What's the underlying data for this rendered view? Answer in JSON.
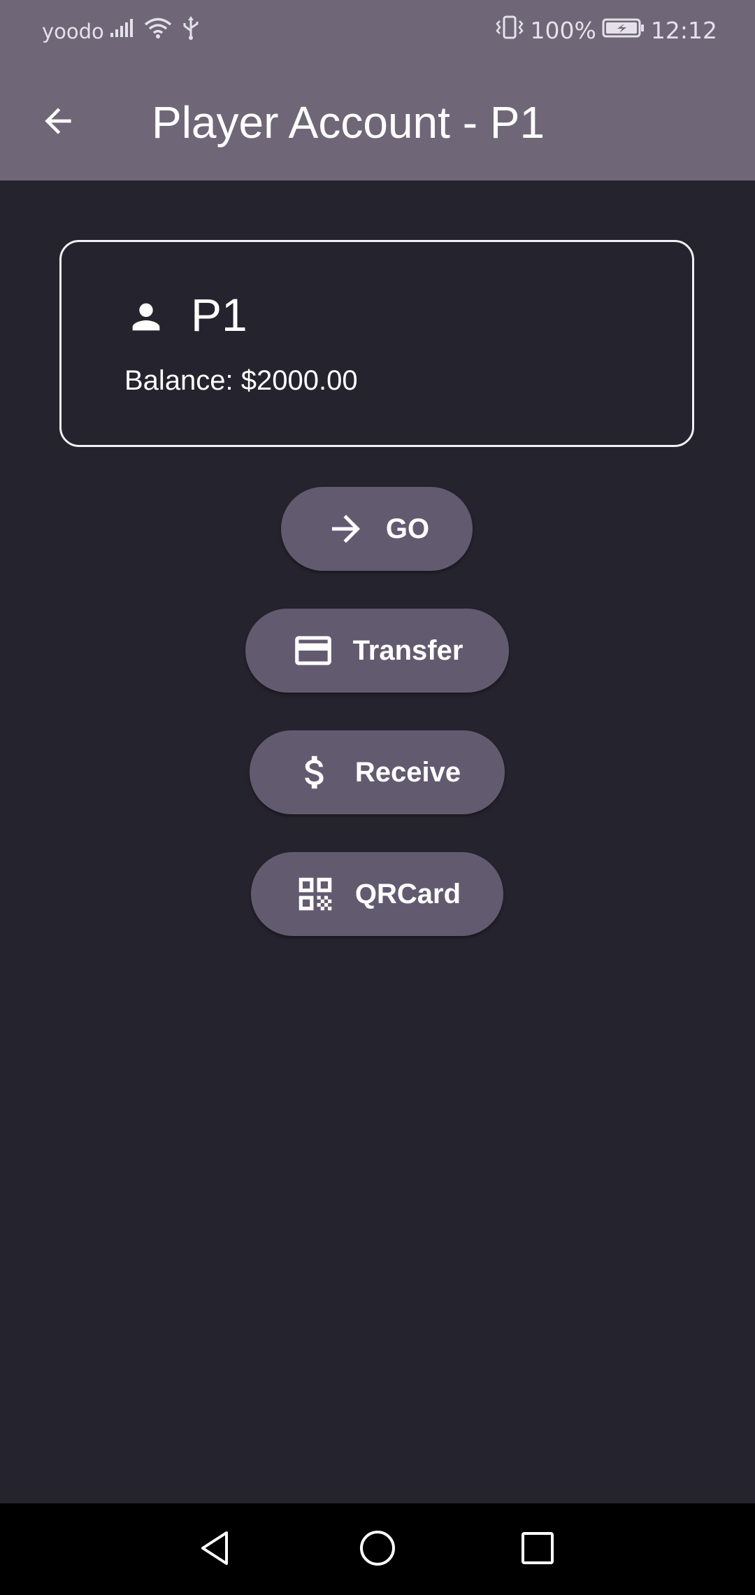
{
  "status_bar": {
    "carrier": "yoodo",
    "battery_percent": "100%",
    "time": "12:12",
    "icons": [
      "signal-icon",
      "wifi-icon",
      "usb-icon",
      "vibrate-icon",
      "battery-charging-icon"
    ]
  },
  "app_bar": {
    "title": "Player Account - P1",
    "back_icon": "arrow-back-icon"
  },
  "player_card": {
    "icon": "person-icon",
    "name": "P1",
    "balance_text": "Balance: $2000.00"
  },
  "actions": [
    {
      "label": "GO",
      "icon": "arrow-forward-icon"
    },
    {
      "label": "Transfer",
      "icon": "credit-card-icon"
    },
    {
      "label": "Receive",
      "icon": "dollar-icon"
    },
    {
      "label": "QRCard",
      "icon": "qr-code-icon"
    }
  ],
  "nav_bar": {
    "buttons": [
      "nav-back-icon",
      "nav-home-icon",
      "nav-recents-icon"
    ]
  },
  "colors": {
    "app_bar": "#6f6778",
    "background": "#25232d",
    "button": "#625b70",
    "nav_bar": "#000000"
  }
}
